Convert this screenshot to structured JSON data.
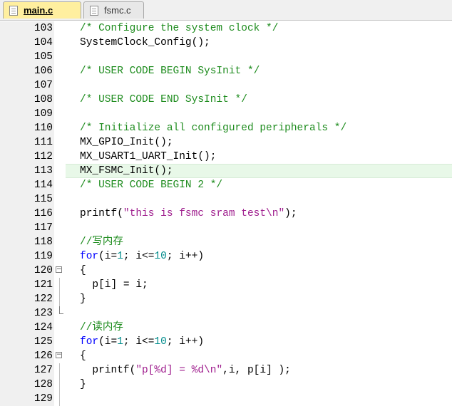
{
  "tabs": [
    {
      "label": "main.c",
      "active": true
    },
    {
      "label": "fsmc.c",
      "active": false
    }
  ],
  "colors": {
    "comment": "#1e8c1e",
    "keyword": "#0000ff",
    "string": "#a0208f",
    "number": "#008c8c",
    "highlight": "#e8f8e8",
    "active_tab": "#ffef9f"
  },
  "highlighted_line": "113",
  "lines": [
    {
      "num": "103",
      "tokens": [
        [
          "comment",
          "/* Configure the system clock */"
        ]
      ]
    },
    {
      "num": "104",
      "tokens": [
        [
          "plain",
          "SystemClock_Config();"
        ]
      ]
    },
    {
      "num": "105",
      "tokens": []
    },
    {
      "num": "106",
      "tokens": [
        [
          "comment",
          "/* USER CODE BEGIN SysInit */"
        ]
      ]
    },
    {
      "num": "107",
      "tokens": []
    },
    {
      "num": "108",
      "tokens": [
        [
          "comment",
          "/* USER CODE END SysInit */"
        ]
      ]
    },
    {
      "num": "109",
      "tokens": []
    },
    {
      "num": "110",
      "tokens": [
        [
          "comment",
          "/* Initialize all configured peripherals */"
        ]
      ]
    },
    {
      "num": "111",
      "tokens": [
        [
          "plain",
          "MX_GPIO_Init();"
        ]
      ]
    },
    {
      "num": "112",
      "tokens": [
        [
          "plain",
          "MX_USART1_UART_Init();"
        ]
      ]
    },
    {
      "num": "113",
      "tokens": [
        [
          "plain",
          "MX_FSMC_Init();"
        ]
      ]
    },
    {
      "num": "114",
      "tokens": [
        [
          "comment",
          "/* USER CODE BEGIN 2 */"
        ]
      ]
    },
    {
      "num": "115",
      "tokens": []
    },
    {
      "num": "116",
      "tokens": [
        [
          "plain",
          "printf("
        ],
        [
          "string",
          "\"this is fsmc sram test\\n\""
        ],
        [
          "plain",
          ");"
        ]
      ]
    },
    {
      "num": "117",
      "tokens": []
    },
    {
      "num": "118",
      "tokens": [
        [
          "comment",
          "//写内存"
        ]
      ]
    },
    {
      "num": "119",
      "tokens": [
        [
          "keyword",
          "for"
        ],
        [
          "plain",
          "(i="
        ],
        [
          "number",
          "1"
        ],
        [
          "plain",
          "; i<="
        ],
        [
          "number",
          "10"
        ],
        [
          "plain",
          "; i++)"
        ]
      ]
    },
    {
      "num": "120",
      "fold": "open",
      "tokens": [
        [
          "plain",
          "{"
        ]
      ]
    },
    {
      "num": "121",
      "fold": "line",
      "tokens": [
        [
          "plain",
          "  p[i] = i;"
        ]
      ]
    },
    {
      "num": "122",
      "fold": "line",
      "tokens": [
        [
          "plain",
          "}"
        ]
      ]
    },
    {
      "num": "123",
      "fold": "end",
      "tokens": []
    },
    {
      "num": "124",
      "tokens": [
        [
          "comment",
          "//读内存"
        ]
      ]
    },
    {
      "num": "125",
      "tokens": [
        [
          "keyword",
          "for"
        ],
        [
          "plain",
          "(i="
        ],
        [
          "number",
          "1"
        ],
        [
          "plain",
          "; i<="
        ],
        [
          "number",
          "10"
        ],
        [
          "plain",
          "; i++)"
        ]
      ]
    },
    {
      "num": "126",
      "fold": "open",
      "tokens": [
        [
          "plain",
          "{"
        ]
      ]
    },
    {
      "num": "127",
      "fold": "line",
      "tokens": [
        [
          "plain",
          "  printf("
        ],
        [
          "string",
          "\"p[%d] = %d\\n\""
        ],
        [
          "plain",
          ",i, p[i] );"
        ]
      ]
    },
    {
      "num": "128",
      "fold": "line",
      "tokens": [
        [
          "plain",
          "}"
        ]
      ]
    },
    {
      "num": "129",
      "fold": "line",
      "tokens": []
    }
  ]
}
